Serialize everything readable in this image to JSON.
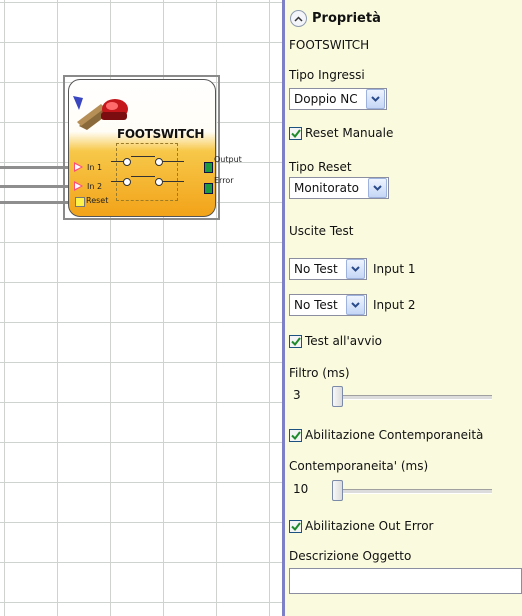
{
  "canvas": {
    "block": {
      "title": "FOOTSWITCH",
      "inputs": [
        "In 1",
        "In 2",
        "Reset"
      ],
      "outputs": [
        "Output",
        "Error"
      ]
    }
  },
  "panel": {
    "header": "Proprietà",
    "subtitle": "FOOTSWITCH",
    "tipo_ingressi": {
      "label": "Tipo Ingressi",
      "value": "Doppio NC"
    },
    "reset_manuale": {
      "label": "Reset Manuale",
      "checked": true
    },
    "tipo_reset": {
      "label": "Tipo Reset",
      "value": "Monitorato"
    },
    "uscite_test": {
      "label": "Uscite Test",
      "rows": [
        {
          "value": "No Test",
          "label": "Input 1"
        },
        {
          "value": "No Test",
          "label": "Input 2"
        }
      ]
    },
    "test_avvio": {
      "label": "Test all'avvio",
      "checked": true
    },
    "filtro": {
      "label": "Filtro (ms)",
      "value": "3"
    },
    "abilitazione_contemporaneita": {
      "label": "Abilitazione Contemporaneità",
      "checked": true
    },
    "contemporaneita": {
      "label": "Contemporaneita' (ms)",
      "value": "10"
    },
    "abilitazione_out_error": {
      "label": "Abilitazione Out Error",
      "checked": true
    },
    "descrizione": {
      "label": "Descrizione Oggetto",
      "value": ""
    }
  }
}
